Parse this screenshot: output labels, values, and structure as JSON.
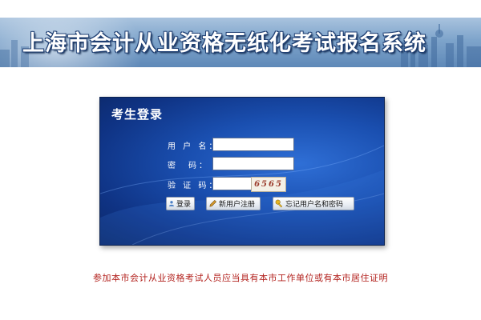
{
  "header": {
    "title": "上海市会计从业资格无纸化考试报名系统"
  },
  "login": {
    "title": "考生登录",
    "username_label": "用 户 名：",
    "password_label": "密　码：",
    "captcha_label": "验 证 码：",
    "username_value": "",
    "password_value": "",
    "captcha_value": "",
    "captcha_text": "6565",
    "buttons": {
      "login": "登录",
      "register": "新用户注册",
      "forgot": "忘记用户名和密码"
    }
  },
  "notice": "参加本市会计从业资格考试人员应当具有本市工作单位或有本市居住证明",
  "colors": {
    "panel": "#1a4fb0",
    "notice": "#b3231f"
  },
  "icons": {
    "login": "user-lock-icon",
    "register": "pencil-icon",
    "forgot": "key-icon"
  }
}
